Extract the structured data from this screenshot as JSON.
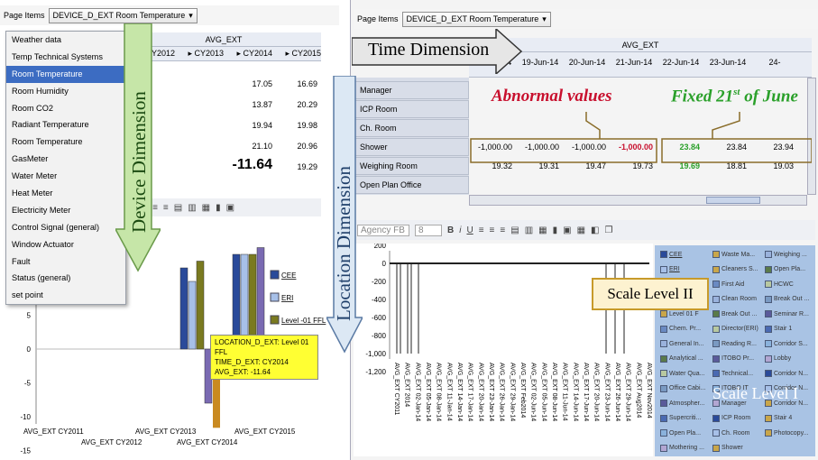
{
  "left": {
    "page_items_label": "Page Items",
    "page_items_value": "DEVICE_D_EXT  Room Temperature",
    "measure_header": "AVG_EXT",
    "year_headers": [
      "CY2012",
      "CY2013",
      "CY2014",
      "CY2015"
    ],
    "table_rows": [
      {
        "cy2014": "17.05",
        "cy2015": "16.69"
      },
      {
        "cy2014": "13.87",
        "cy2015": "20.29"
      },
      {
        "cy2014": "19.94",
        "cy2015": "19.98"
      },
      {
        "cy2014": "21.10",
        "cy2015": "20.96"
      },
      {
        "cy2014": "-11.64",
        "cy2015": "19.29"
      }
    ],
    "menu_items": [
      "Weather data",
      "Temp Technical Systems",
      "Room Temperature",
      "Room Humidity",
      "Room CO2",
      "Radiant Temperature",
      "Room Temperature",
      "GasMeter",
      "Water Meter",
      "Heat Meter",
      "Electricity Meter",
      "Control Signal (general)",
      "Window Actuator",
      "Fault",
      "Status (general)",
      "set point"
    ],
    "menu_active_index": 2,
    "toolbar_glyph": "U",
    "device_dimension_label": "Device Dimension",
    "chart": {
      "y_ticks": [
        "5",
        "0",
        "-5",
        "-10",
        "-15"
      ],
      "x_ticks_row1": [
        "AVG_EXT CY2011",
        "AVG_EXT CY2013",
        "AVG_EXT CY2015"
      ],
      "x_ticks_row2": [
        "AVG_EXT CY2012",
        "AVG_EXT CY2014"
      ],
      "legend": [
        "CEE",
        "ERI",
        "Level -01 FFL",
        "FFL"
      ],
      "tooltip": [
        "LOCATION_D_EXT: Level 01 FFL",
        "TIME_D_EXT: CY2014",
        "AVG_EXT: -11.64"
      ]
    }
  },
  "right": {
    "page_items_label": "Page Items",
    "page_items_value": "DEVICE_D_EXT  Room Temperature",
    "measure_header": "AVG_EXT",
    "time_dimension_label": "Time Dimension",
    "date_headers": [
      "18-Jun-14",
      "19-Jun-14",
      "20-Jun-14",
      "21-Jun-14",
      "22-Jun-14",
      "23-Jun-14",
      "24-"
    ],
    "rows": [
      {
        "label": "Manager",
        "values": []
      },
      {
        "label": "ICP Room",
        "values": []
      },
      {
        "label": "Ch. Room",
        "values": []
      },
      {
        "label": "Shower",
        "values": [
          "-1,000.00",
          "-1,000.00",
          "-1,000.00",
          "-1,000.00",
          "23.84",
          "23.84",
          "23.94"
        ]
      },
      {
        "label": "Weighing Room",
        "values": [
          "19.32",
          "19.31",
          "19.47",
          "19.73",
          "19.69",
          "18.81",
          "19.03"
        ]
      },
      {
        "label": "Open Plan Office",
        "values": []
      }
    ],
    "abnormal_label": "Abnormal values",
    "fixed_label_main": "Fixed 21",
    "fixed_label_sup": "st",
    "fixed_label_tail": " of June",
    "location_dimension_label": "Location Dimension",
    "toolbar_font": "Agency FB",
    "toolbar_size": "8",
    "chart": {
      "y_ticks": [
        "200",
        "0",
        "-200",
        "-400",
        "-600",
        "-800",
        "-1,000",
        "-1,200"
      ],
      "x_labels": [
        "AVG_EXT CY2011",
        "AVG_EXT 2014",
        "AVG_EXT 02-Jan-14",
        "AVG_EXT 05-Jan-14",
        "AVG_EXT 08-Jan-14",
        "AVG_EXT 11-Jan-14",
        "AVG_EXT 14-Jan-14",
        "AVG_EXT 17-Jan-14",
        "AVG_EXT 20-Jan-14",
        "AVG_EXT 23-Jan-14",
        "AVG_EXT 26-Jan-14",
        "AVG_EXT 29-Jan-14",
        "AVG_EXT Feb2014",
        "AVG_EXT 02-Jun-14",
        "AVG_EXT 05-Jun-14",
        "AVG_EXT 08-Jun-14",
        "AVG_EXT 11-Jun-14",
        "AVG_EXT 14-Jun-14",
        "AVG_EXT 17-Jun-14",
        "AVG_EXT 20-Jun-14",
        "AVG_EXT 23-Jun-14",
        "AVG_EXT 26-Jun-14",
        "AVG_EXT 29-Jun-14",
        "AVG_EXT Aug2014",
        "AVG_EXT Nov2014"
      ],
      "scale_level_2": "Scale Level II",
      "scale_level_1": "Scale Level I",
      "legend_col1": [
        "CEE",
        "ERI",
        "Level -01",
        "Level 01 F",
        "Level 01 F",
        "Chem. Pr...",
        "General In...",
        "Analytical ...",
        "Water Qua...",
        "Office Cabi...",
        "Atmospher...",
        "Supercriti...",
        "Open Pla...",
        "Mothering ..."
      ],
      "legend_col2": [
        "Waste Ma...",
        "Cleaners S...",
        "First Aid",
        "Clean Room",
        "Break Out ...",
        "Director(ERI)",
        "Reading R...",
        "ITOBO Pr...",
        "Technical...",
        "ITOBO IT",
        "Manager",
        "ICP Room",
        "Ch. Room",
        "Shower"
      ],
      "legend_col3": [
        "Weighing ...",
        "Open Pla...",
        "HCWC",
        "Break Out ...",
        "Seminar R...",
        "Stair 1",
        "Corridor S...",
        "Lobby",
        "Corridor N...",
        "Corridor N...",
        "Corridor N...",
        "Stair 4",
        "Photocopy..."
      ]
    }
  },
  "colors": {
    "abnormal": "#c8102e",
    "fixed": "#2aa02a",
    "menu_active": "#3c6cc2",
    "legend_bg": "#a9c3e4"
  }
}
